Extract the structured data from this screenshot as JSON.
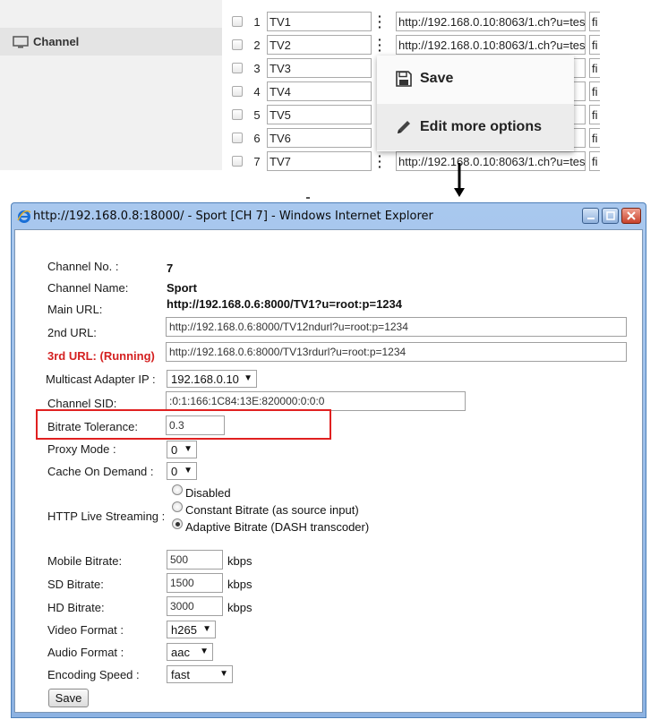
{
  "sidebar": {
    "channel_label": "Channel"
  },
  "channel_rows": [
    {
      "num": "1",
      "name": "TV1",
      "url": "http://192.168.0.10:8063/1.ch?u=tes",
      "extra": "fi"
    },
    {
      "num": "2",
      "name": "TV2",
      "url": "http://192.168.0.10:8063/1.ch?u=tes",
      "extra": "fi"
    },
    {
      "num": "3",
      "name": "TV3",
      "url": "",
      "extra": "fi"
    },
    {
      "num": "4",
      "name": "TV4",
      "url": "",
      "extra": "fi"
    },
    {
      "num": "5",
      "name": "TV5",
      "url": "",
      "extra": "fi"
    },
    {
      "num": "6",
      "name": "TV6",
      "url": "",
      "extra": "fi"
    },
    {
      "num": "7",
      "name": "TV7",
      "url": "http://192.168.0.10:8063/1.ch?u=tes",
      "extra": "fi"
    }
  ],
  "context_menu": {
    "save": "Save",
    "edit_more": "Edit more options"
  },
  "window": {
    "title": "http://192.168.0.8:18000/ - Sport [CH 7] - Windows Internet Explorer"
  },
  "form": {
    "channel_no_label": "Channel No. :",
    "channel_no_value": "7",
    "channel_name_label": "Channel Name:",
    "channel_name_value": "Sport",
    "main_url_label": "Main URL:",
    "main_url_value": "http://192.168.0.6:8000/TV1?u=root:p=1234",
    "url2_label": "2nd URL:",
    "url2_value": "http://192.168.0.6:8000/TV12ndurl?u=root:p=1234",
    "url3_label": "3rd URL: (Running)",
    "url3_value": "http://192.168.0.6:8000/TV13rdurl?u=root:p=1234",
    "multicast_label": "Multicast Adapter IP :",
    "multicast_value": "192.168.0.10",
    "sid_label": "Channel SID:",
    "sid_value": ":0:1:166:1C84:13E:820000:0:0:0",
    "bitrate_tol_label": "Bitrate Tolerance:",
    "bitrate_tol_value": "0.3",
    "proxy_label": "Proxy Mode :",
    "proxy_value": "0",
    "cache_label": "Cache On Demand :",
    "cache_value": "0",
    "hls_label": "HTTP Live Streaming :",
    "hls_options": [
      "Disabled",
      "Constant Bitrate (as source input)",
      "Adaptive Bitrate (DASH transcoder)"
    ],
    "hls_selected": 2,
    "mobile_label": "Mobile Bitrate:",
    "mobile_value": "500",
    "sd_label": "SD Bitrate:",
    "sd_value": "1500",
    "hd_label": "HD Bitrate:",
    "hd_value": "3000",
    "unit": "kbps",
    "video_label": "Video Format :",
    "video_value": "h265",
    "audio_label": "Audio Format :",
    "audio_value": "aac",
    "speed_label": "Encoding Speed :",
    "speed_value": "fast",
    "save_label": "Save"
  },
  "colors": {
    "running_red": "#d42020",
    "highlight_red": "#e02020",
    "ie_frame": "#8cb2e2"
  }
}
